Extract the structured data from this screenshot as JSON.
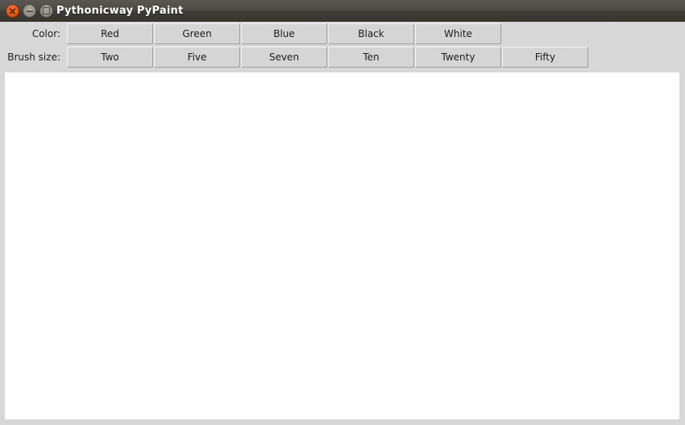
{
  "window": {
    "title": "Pythonicway PyPaint",
    "controls": [
      {
        "name": "close",
        "glyph": "×"
      },
      {
        "name": "minimize",
        "glyph": "−"
      },
      {
        "name": "maximize",
        "glyph": "□"
      }
    ]
  },
  "toolbar": {
    "color_row": {
      "label": "Color:",
      "buttons": [
        {
          "label": "Red"
        },
        {
          "label": "Green"
        },
        {
          "label": "Blue"
        },
        {
          "label": "Black"
        },
        {
          "label": "White"
        }
      ]
    },
    "brush_row": {
      "label": "Brush size:",
      "buttons": [
        {
          "label": "Two"
        },
        {
          "label": "Five"
        },
        {
          "label": "Seven"
        },
        {
          "label": "Ten"
        },
        {
          "label": "Twenty"
        },
        {
          "label": "Fifty"
        }
      ]
    }
  },
  "canvas": {
    "background": "#ffffff"
  },
  "colors": {
    "titlebar_top": "#5a5852",
    "titlebar_bottom": "#37362f",
    "toolbar_bg": "#d7d7d7",
    "button_face": "#d5d5d5",
    "text": "#1b1b1b",
    "close_button": "#e2561d",
    "window_button_gray": "#8d8b85"
  }
}
